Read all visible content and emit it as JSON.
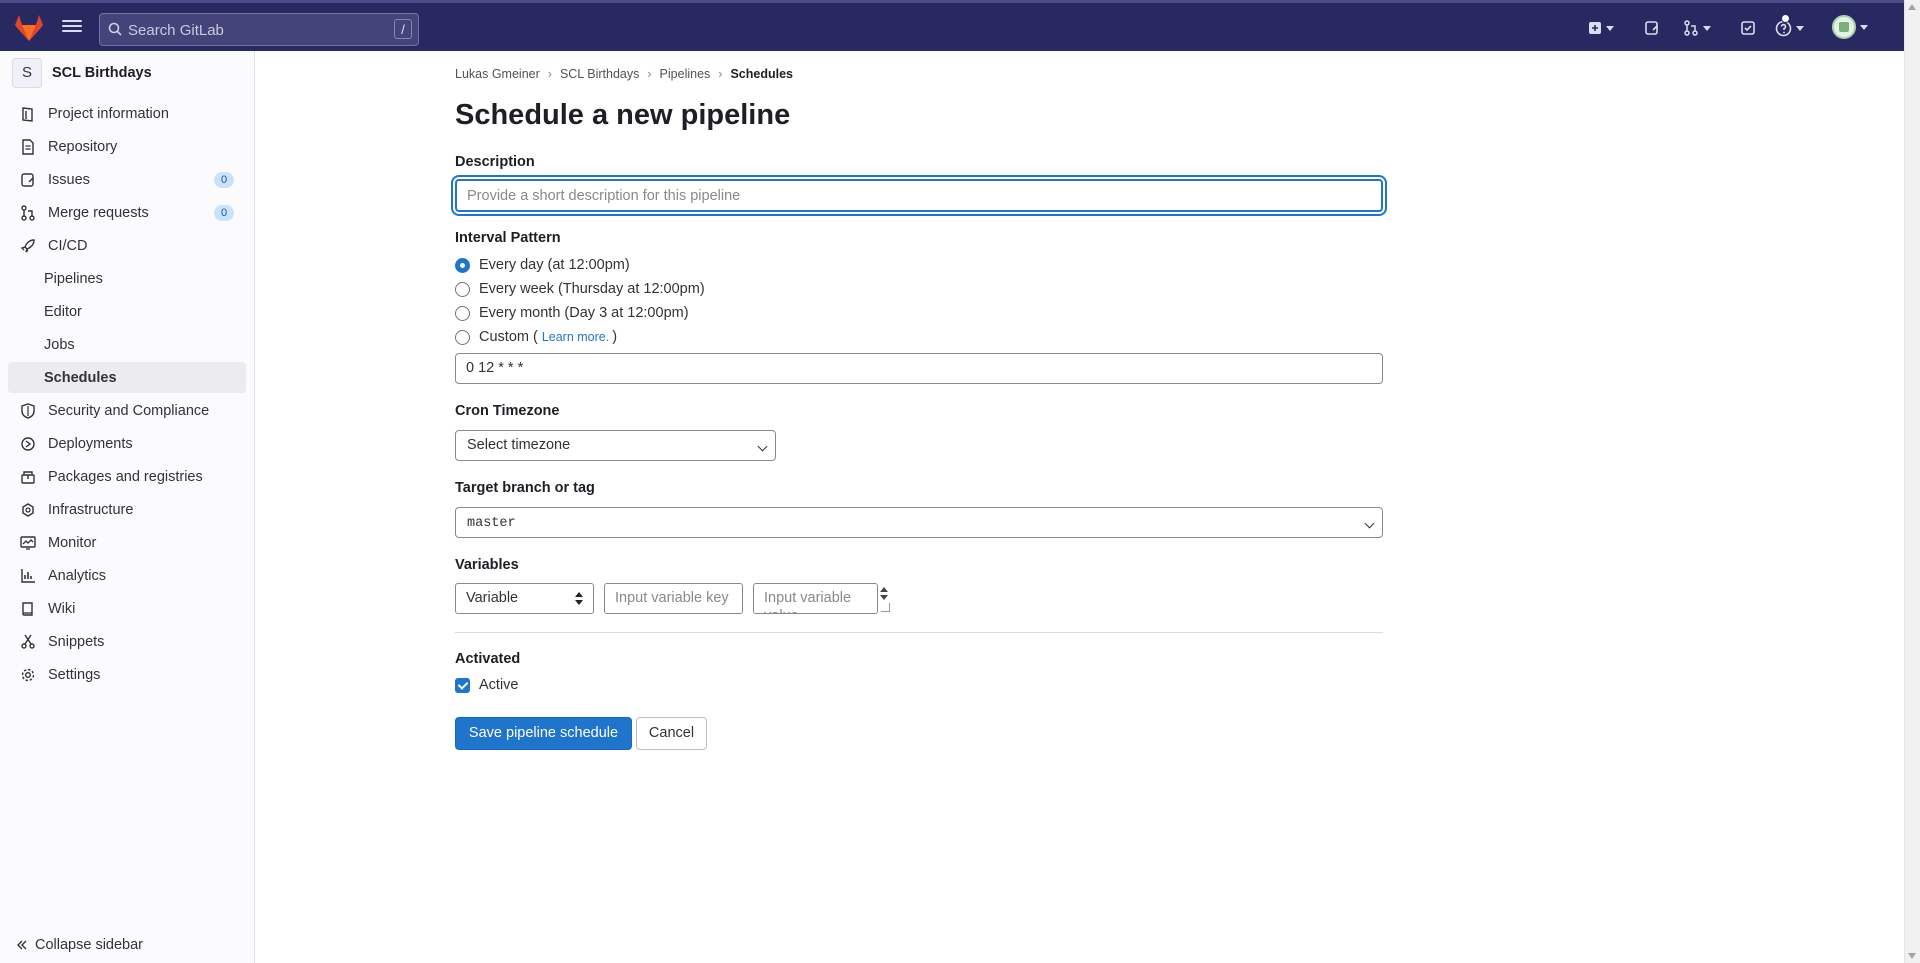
{
  "search": {
    "placeholder": "Search GitLab",
    "shortcut": "/"
  },
  "sidebar": {
    "project_initial": "S",
    "project_name": "SCL Birthdays",
    "items": [
      {
        "label": "Project information",
        "icon": "project-icon"
      },
      {
        "label": "Repository",
        "icon": "doc-icon"
      },
      {
        "label": "Issues",
        "icon": "issues-icon",
        "count": "0"
      },
      {
        "label": "Merge requests",
        "icon": "merge-request-icon",
        "count": "0"
      },
      {
        "label": "CI/CD",
        "icon": "rocket-icon"
      },
      {
        "label": "Pipelines"
      },
      {
        "label": "Editor"
      },
      {
        "label": "Jobs"
      },
      {
        "label": "Schedules"
      },
      {
        "label": "Security and Compliance",
        "icon": "shield-icon"
      },
      {
        "label": "Deployments",
        "icon": "deployments-icon"
      },
      {
        "label": "Packages and registries",
        "icon": "package-icon"
      },
      {
        "label": "Infrastructure",
        "icon": "cloud-icon"
      },
      {
        "label": "Monitor",
        "icon": "monitor-icon"
      },
      {
        "label": "Analytics",
        "icon": "chart-icon"
      },
      {
        "label": "Wiki",
        "icon": "book-icon"
      },
      {
        "label": "Snippets",
        "icon": "scissors-icon"
      },
      {
        "label": "Settings",
        "icon": "gear-icon"
      }
    ],
    "collapse_label": "Collapse sidebar"
  },
  "breadcrumb": [
    "Lukas Gmeiner",
    "SCL Birthdays",
    "Pipelines",
    "Schedules"
  ],
  "page": {
    "title": "Schedule a new pipeline",
    "description_label": "Description",
    "description_placeholder": "Provide a short description for this pipeline",
    "interval_label": "Interval Pattern",
    "interval_options": [
      "Every day (at 12:00pm)",
      "Every week (Thursday at 12:00pm)",
      "Every month (Day 3 at 12:00pm)",
      "Custom ("
    ],
    "learn_more": "Learn more.",
    "custom_close": ")",
    "cron_value": "0 12 * * *",
    "timezone_label": "Cron Timezone",
    "timezone_value": "Select timezone",
    "target_label": "Target branch or tag",
    "target_value": "master",
    "variables_label": "Variables",
    "variable_type": "Variable",
    "variable_key_placeholder": "Input variable key",
    "variable_value_placeholder": "Input variable value",
    "activated_label": "Activated",
    "active_label": "Active",
    "save_label": "Save pipeline schedule",
    "cancel_label": "Cancel"
  },
  "colors": {
    "topbar": "#292961",
    "primary": "#1f75cb"
  }
}
